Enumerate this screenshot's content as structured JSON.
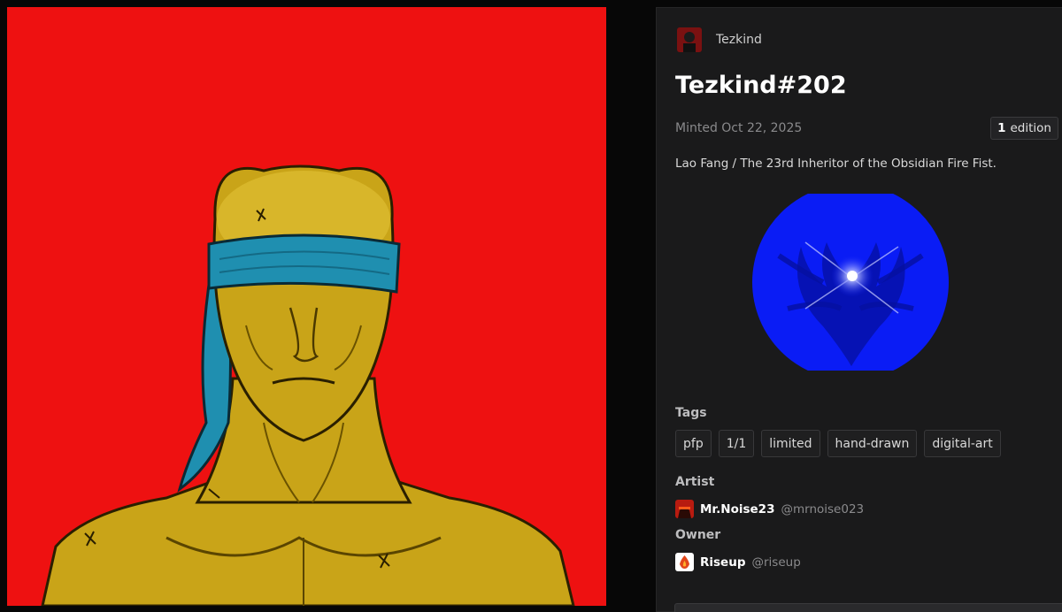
{
  "collection": {
    "name": "Tezkind"
  },
  "token": {
    "title": "Tezkind#202",
    "minted": "Minted Oct 22, 2025",
    "edition_count": "1",
    "edition_label": "edition",
    "description": "Lao Fang / The 23rd Inheritor of the Obsidian Fire Fist."
  },
  "tags": {
    "label": "Tags",
    "items": [
      "pfp",
      "1/1",
      "limited",
      "hand-drawn",
      "digital-art"
    ]
  },
  "artist": {
    "label": "Artist",
    "name": "Mr.Noise23",
    "handle": "@mrnoise023"
  },
  "owner": {
    "label": "Owner",
    "name": "Riseup",
    "handle": "@riseup"
  },
  "colors": {
    "artwork_background": "#ee1111",
    "skin": "#c9a418",
    "blindfold": "#1f8fb0",
    "emblem": "#0a1cf5",
    "panel": "#1a1a1b"
  },
  "icons": {
    "collection_avatar": "collection-avatar-icon",
    "artist_avatar": "artist-avatar",
    "owner_avatar": "owner-avatar"
  }
}
